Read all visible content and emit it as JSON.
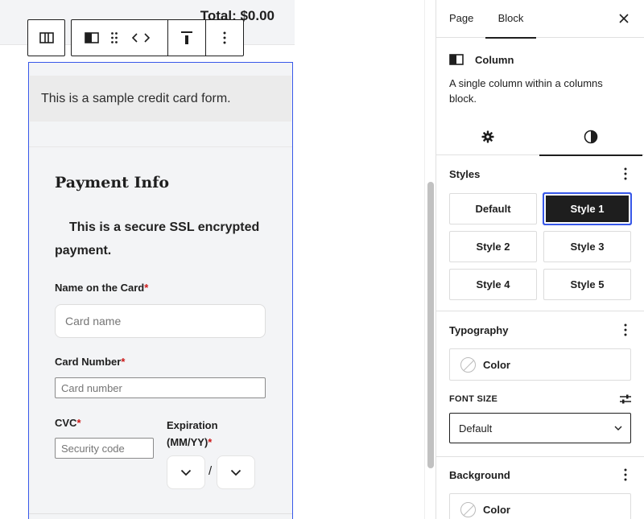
{
  "canvas": {
    "total_text": "Total: $0.00",
    "sample_paragraph": "This is a sample credit card form.",
    "payment_title": "Payment Info",
    "ssl_text": "This is a secure SSL encrypted payment.",
    "name_label": "Name on the Card",
    "name_placeholder": "Card name",
    "card_label": "Card Number",
    "card_placeholder": "Card number",
    "cvc_label": "CVC",
    "cvc_placeholder": "Security code",
    "expiration_label": "Expiration (MM/YY)",
    "required_mark": "*",
    "exp_separator": "/"
  },
  "toolbar": {
    "icons": [
      "columns-icon",
      "column-icon",
      "drag-handle-icon",
      "move-arrows-icon",
      "align-top-icon",
      "more-options-icon"
    ]
  },
  "sidebar": {
    "tabs": {
      "page": "Page",
      "block": "Block"
    },
    "block_name": "Column",
    "block_description": "A single column within a columns block.",
    "styles_title": "Styles",
    "styles": [
      "Default",
      "Style 1",
      "Style 2",
      "Style 3",
      "Style 4",
      "Style 5"
    ],
    "active_style": "Style 1",
    "typography_title": "Typography",
    "typography_color_label": "Color",
    "font_size_label": "FONT SIZE",
    "font_size_value": "Default",
    "background_title": "Background",
    "background_color_label": "Color"
  },
  "colors": {
    "accent": "#3858e9",
    "dark": "#1e1e1e",
    "required": "#cc1818",
    "block_bg": "#f3f4f6"
  }
}
